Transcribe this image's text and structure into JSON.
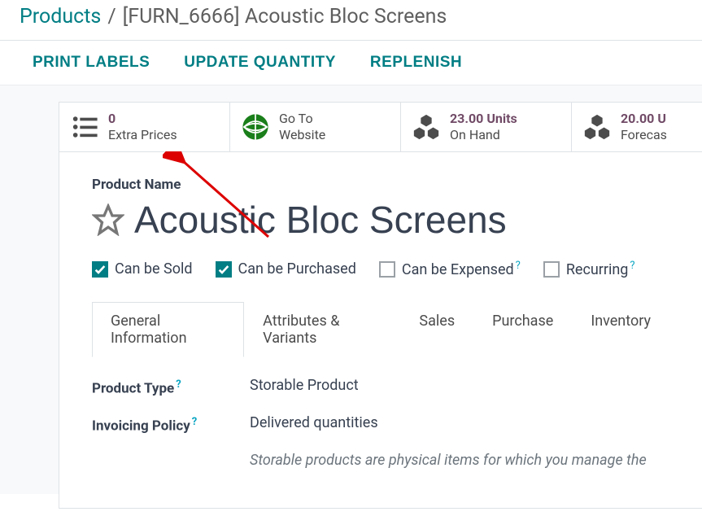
{
  "breadcrumb": {
    "root": "Products",
    "current": "[FURN_6666] Acoustic Bloc Screens"
  },
  "actions": {
    "print": "PRINT LABELS",
    "update": "UPDATE QUANTITY",
    "replenish": "REPLENISH"
  },
  "stats": {
    "extra": {
      "value": "0",
      "label": "Extra Prices"
    },
    "website": {
      "line1": "Go To",
      "line2": "Website"
    },
    "onhand": {
      "value": "23.00 Units",
      "label": "On Hand"
    },
    "forecast": {
      "value": "20.00 U",
      "label": "Forecas"
    }
  },
  "product": {
    "name_label": "Product Name",
    "name": "Acoustic Bloc Screens",
    "can_sold": "Can be Sold",
    "can_purchased": "Can be Purchased",
    "can_expensed": "Can be Expensed",
    "recurring": "Recurring"
  },
  "tabs": {
    "general": "General Information",
    "attrs": "Attributes & Variants",
    "sales": "Sales",
    "purchase": "Purchase",
    "inventory": "Inventory"
  },
  "fields": {
    "type_label": "Product Type",
    "type_value": "Storable Product",
    "invoicing_label": "Invoicing Policy",
    "invoicing_value": "Delivered quantities",
    "help": "Storable products are physical items for which you manage the"
  }
}
